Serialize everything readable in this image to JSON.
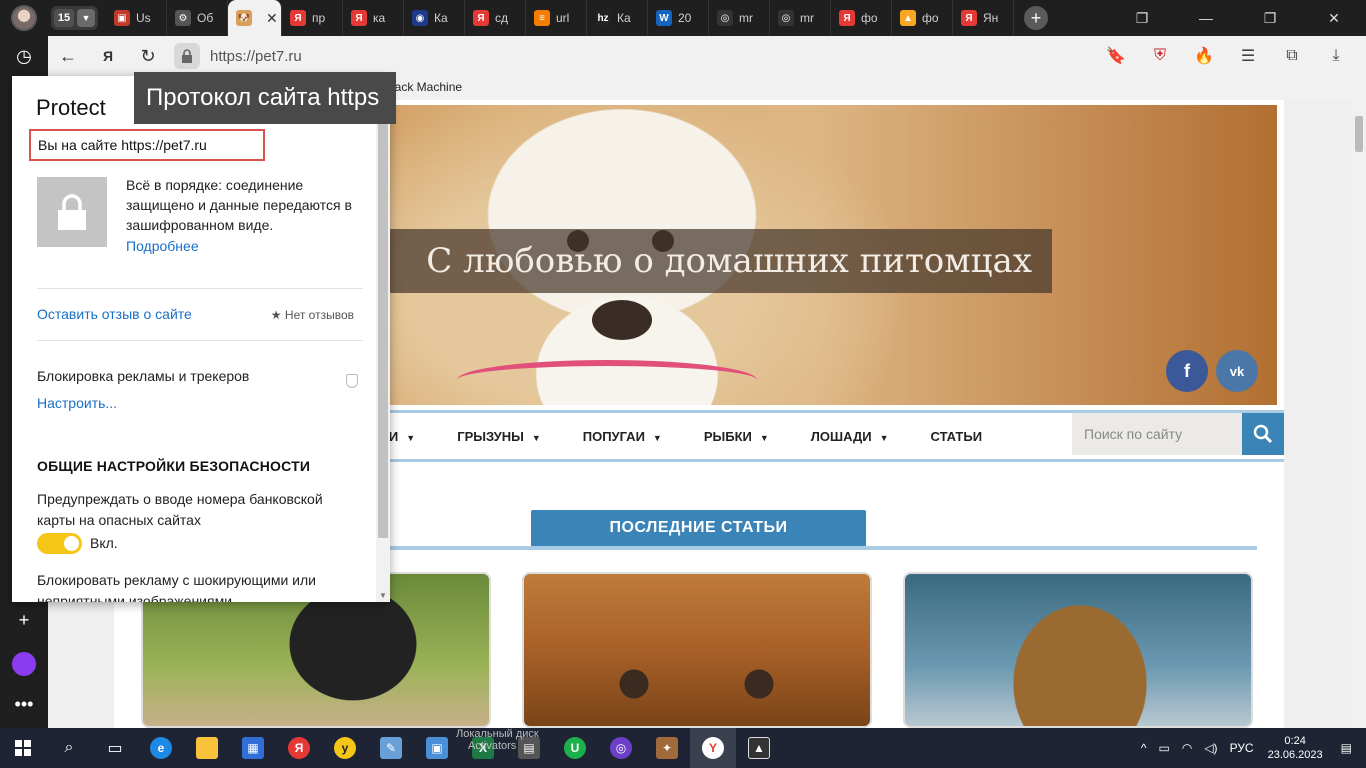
{
  "tabstrip": {
    "tab_count": "15",
    "tabs": [
      {
        "label": "Us",
        "color": "#c0392b",
        "glyph": "▣"
      },
      {
        "label": "Об",
        "color": "#555555",
        "glyph": "⚙"
      },
      {
        "label": "",
        "color": "#d9a05b",
        "glyph": "🐶",
        "active": true
      },
      {
        "label": "пр",
        "color": "#e53935",
        "glyph": "Я"
      },
      {
        "label": "ка",
        "color": "#e53935",
        "glyph": "Я"
      },
      {
        "label": "Ка",
        "color": "#1e3a8a",
        "glyph": "◉"
      },
      {
        "label": "сд",
        "color": "#e53935",
        "glyph": "Я"
      },
      {
        "label": "url",
        "color": "#f57c00",
        "glyph": "≡"
      },
      {
        "label": "Ка",
        "color": "#222222",
        "glyph": "hz"
      },
      {
        "label": "20",
        "color": "#1565c0",
        "glyph": "W"
      },
      {
        "label": "mr",
        "color": "#333333",
        "glyph": "◎"
      },
      {
        "label": "mr",
        "color": "#333333",
        "glyph": "◎"
      },
      {
        "label": "фо",
        "color": "#e53935",
        "glyph": "Я"
      },
      {
        "label": "фо",
        "color": "#f9a825",
        "glyph": "▲"
      },
      {
        "label": "Ян",
        "color": "#e53935",
        "glyph": "Я"
      }
    ]
  },
  "address": {
    "url": "https://pet7.ru"
  },
  "bookmarks": {
    "wayback": "back Machine"
  },
  "tooltip": {
    "text": "Протокол сайта https"
  },
  "protect": {
    "title": "Protect",
    "site_line": "Вы на сайте https://pet7.ru",
    "status": "Всё в порядке: соединение защищено и данные передаются в зашифрованном виде.",
    "more_link": "Подробнее",
    "feedback_link": "Оставить отзыв о сайте",
    "no_reviews": "Нет отзывов",
    "block_label": "Блокировка рекламы и трекеров",
    "configure_link": "Настроить...",
    "general_heading": "ОБЩИЕ НАСТРОЙКИ БЕЗОПАСНОСТИ",
    "warn_label": "Предупреждать о вводе номера банковской карты на опасных сайтах",
    "toggle_state": "Вкл.",
    "shock_label": "Блокировать рекламу с шокирующими или неприятными изображениями"
  },
  "site": {
    "hero_title": "С любовью о домашних питомцах",
    "social_fb": "f",
    "social_vk": "vk",
    "menu": [
      {
        "label": "КИ",
        "dropdown": true
      },
      {
        "label": "ГРЫЗУНЫ",
        "dropdown": true
      },
      {
        "label": "ПОПУГАИ",
        "dropdown": true
      },
      {
        "label": "РЫБКИ",
        "dropdown": true
      },
      {
        "label": "ЛОШАДИ",
        "dropdown": true
      },
      {
        "label": "СТАТЬИ",
        "dropdown": false
      }
    ],
    "search_placeholder": "Поиск по сайту",
    "latest_heading": "ПОСЛЕДНИЕ СТАТЬИ"
  },
  "taskbar": {
    "popup_line1": "Локальный диск",
    "popup_line2": "Activators",
    "lang": "РУС",
    "time": "0:24",
    "date": "23.06.2023"
  },
  "colors": {
    "accent_blue": "#3a84b8",
    "highlight_red": "#d9534f",
    "toggle_yellow": "#f5c518",
    "link_blue": "#1a6fc7"
  }
}
